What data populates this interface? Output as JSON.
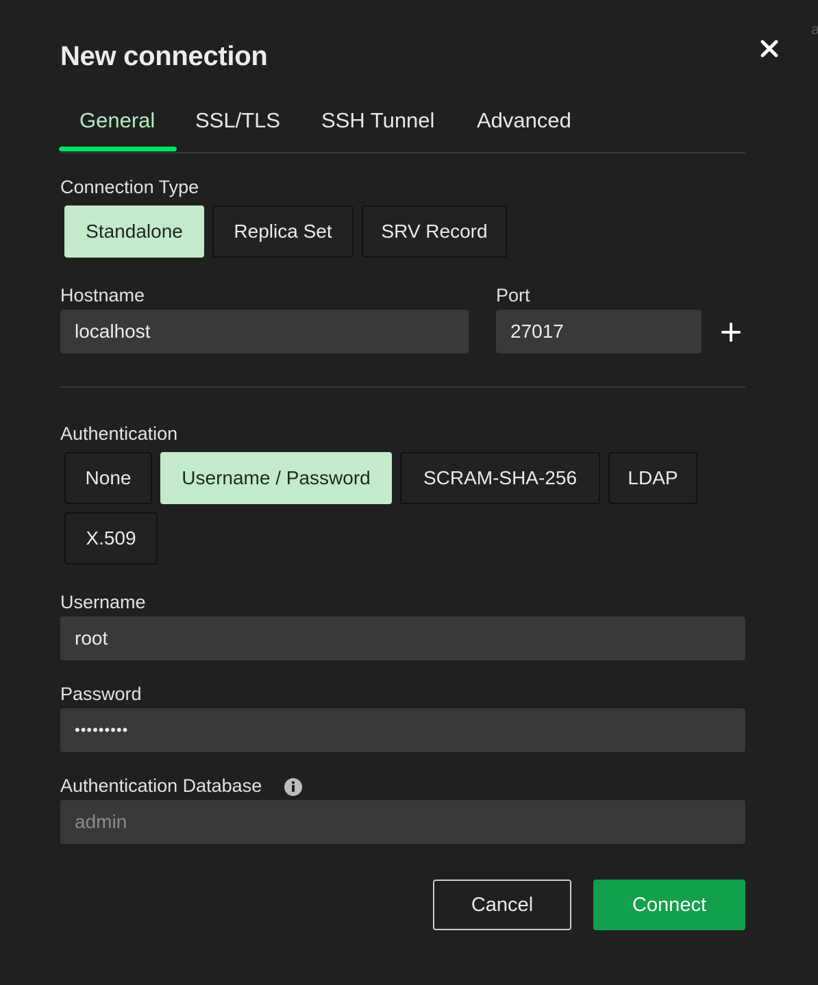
{
  "dialog": {
    "title": "New connection",
    "close_icon": "close-icon",
    "corner_fragment": "a"
  },
  "tabs": [
    {
      "label": "General",
      "active": true
    },
    {
      "label": "SSL/TLS",
      "active": false
    },
    {
      "label": "SSH Tunnel",
      "active": false
    },
    {
      "label": "Advanced",
      "active": false
    }
  ],
  "connection_type": {
    "label": "Connection Type",
    "options": [
      "Standalone",
      "Replica Set",
      "SRV Record"
    ],
    "selected": "Standalone"
  },
  "hostname": {
    "label": "Hostname",
    "value": "localhost"
  },
  "port": {
    "label": "Port",
    "value": "27017",
    "add_icon": "plus-icon"
  },
  "authentication": {
    "label": "Authentication",
    "options": [
      "None",
      "Username / Password",
      "SCRAM-SHA-256",
      "LDAP",
      "X.509"
    ],
    "selected": "Username / Password"
  },
  "username": {
    "label": "Username",
    "value": "root"
  },
  "password": {
    "label": "Password",
    "value": "•••••••••"
  },
  "auth_database": {
    "label": "Authentication Database",
    "placeholder": "admin",
    "info_icon": "info-icon"
  },
  "footer": {
    "cancel_label": "Cancel",
    "connect_label": "Connect"
  },
  "colors": {
    "background": "#202020",
    "accent_green": "#00e461",
    "selected_fill": "#c3ebcb",
    "connect_button": "#13a04b",
    "input_bg": "#393939"
  }
}
